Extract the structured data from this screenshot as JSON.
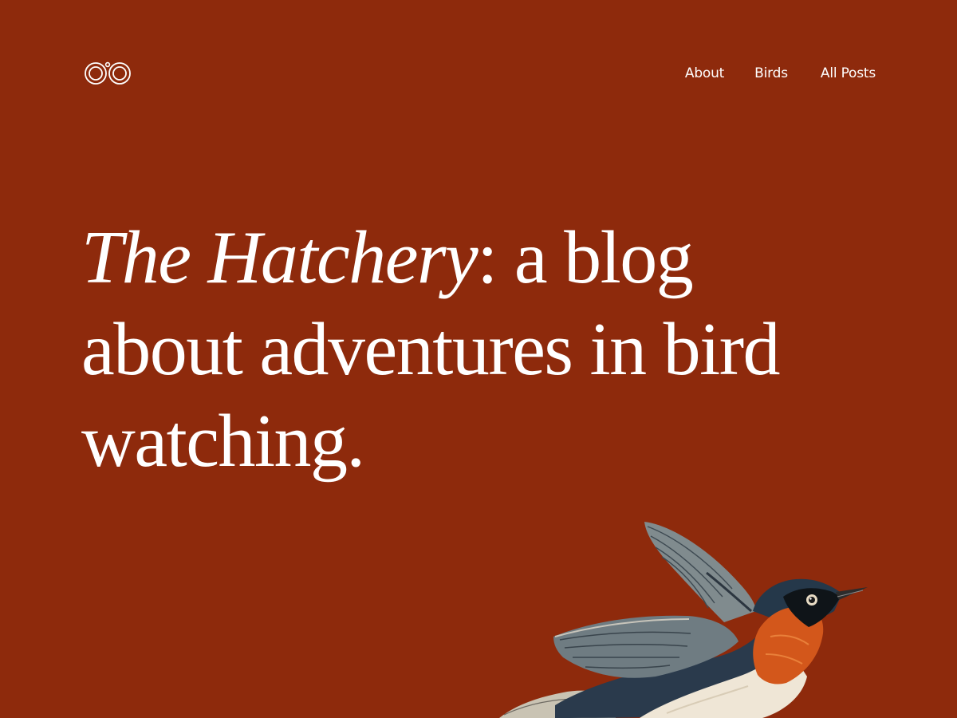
{
  "header": {
    "logo_icon": "binoculars-icon",
    "nav": [
      {
        "label": "About"
      },
      {
        "label": "Birds"
      },
      {
        "label": "All Posts"
      }
    ]
  },
  "hero": {
    "title_italic": "The Hatchery",
    "title_rest": ": a blog about adventures in bird watching."
  },
  "illustration": {
    "icon": "bird-illustration",
    "colors": {
      "background": "#8e2a0c",
      "breast": "#d2561a",
      "head": "#243848",
      "wing": "#7d8a8f",
      "belly": "#efe6d6"
    }
  }
}
